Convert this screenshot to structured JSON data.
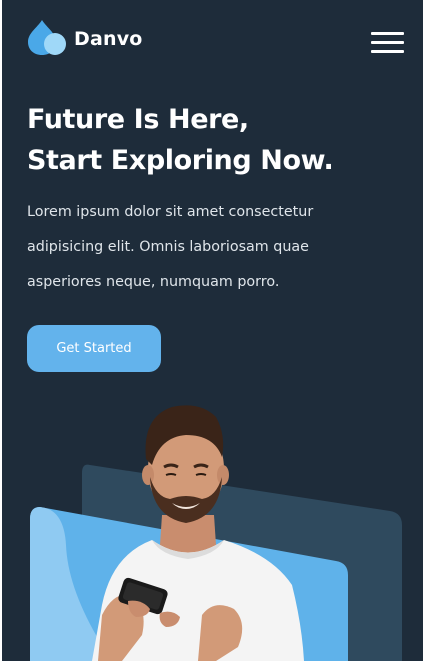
{
  "brand": {
    "name": "Danvo",
    "logo_icon": "droplet-icon",
    "colors": {
      "background": "#1e2c3a",
      "accent": "#63b3ec",
      "panel": "#2f4a5e"
    }
  },
  "nav": {
    "menu_icon": "hamburger-menu-icon"
  },
  "hero": {
    "title_lines": [
      "Future Is Here,",
      "Start Exploring Now."
    ],
    "text_lines": [
      "Lorem ipsum dolor sit amet consectetur",
      "adipisicing elit. Omnis laboriosam quae",
      "asperiores neque, numquam porro."
    ],
    "cta_label": "Get Started"
  },
  "illustration": {
    "subject": "man-with-phone-illustration"
  }
}
